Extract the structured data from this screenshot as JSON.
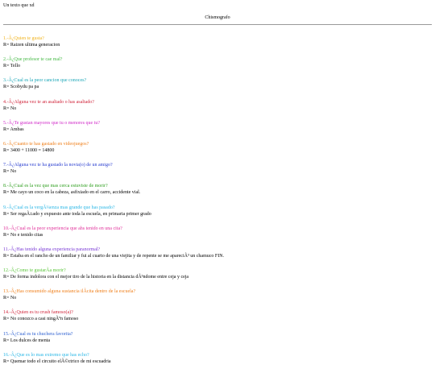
{
  "intro": "Un texto que xd",
  "title": "Chismografo",
  "colors": {
    "orange": "#f39c12",
    "green": "#43b943",
    "teal": "#1aa6b7",
    "red": "#d0243a",
    "magenta": "#d028c8",
    "orange2": "#ef7f1a",
    "blue": "#2b3fd0",
    "lime": "#2e9e1e",
    "sky": "#2bb7e6",
    "pink": "#e0309a",
    "gray": "#333333"
  },
  "questions": [
    {
      "q": "1.-Â¿Quien te gusta?",
      "a": "R= Raizen ultima generacion",
      "color": "#f0b21a"
    },
    {
      "q": "2.-Â¿Que profesor te cae mal?",
      "a": "R= Tello",
      "color": "#43b943"
    },
    {
      "q": "3.-Â¿Cual es la peor cancion que conoces?",
      "a": "R= Scobydu pa pa",
      "color": "#1aa6b7"
    },
    {
      "q": "4.-Â¿Alguna vez te an asaltado o has asaltado?",
      "a": "R= No",
      "color": "#d0243a"
    },
    {
      "q": "5.-Â¿Te gustan mayores que tu o menores que tu?",
      "a": "R= Ambas",
      "color": "#d028c8"
    },
    {
      "q": "6.-Â¿Cuanto te has gastado en videojuegos?",
      "a": "R= 3400 + 11000 = 14800",
      "color": "#ef7f1a"
    },
    {
      "q": "7.-Â¿Alguna vez te ha gustado la novia(o) de un amigo?",
      "a": "R= No",
      "color": "#2b3fd0"
    },
    {
      "q": "8.-Â¿Cual es la vez que mas cerca estuviste de morir?",
      "a": "R= Me cayo un coco en la cabeza, asfixiado en el carro, accidente vial.",
      "color": "#2e9e1e"
    },
    {
      "q": "9.-Â¿Cual es la vergÃ¼enza mas grande que has pasado?",
      "a": "R= Ser regaÃ±ado y expuesto ante toda la escuela, en primaria primer grado",
      "color": "#2bb7e6"
    },
    {
      "q": "10.-Â¿Cual es la peor experiencia que ahs tenido en una cita?",
      "a": "R= No e tenido citas",
      "color": "#e0309a"
    },
    {
      "q": "11.-Â¿Has tenido alguna experiencia paranormal?",
      "a": "R= Estaba en el rancho de un familiar y fui al cuarto de una viejita y de repente se me apareciÃ³ un chamuco FIN.",
      "color": "#7a3ad6"
    },
    {
      "q": "12.-Â¿Como te gustarÃ­a morir?",
      "a": "R= De forma indolora con el mejor tiro de la historia en la distancia dÃ³ndome entre ceja y ceja",
      "color": "#5ac53a"
    },
    {
      "q": "13.-Â¿Has consumido alguna sustancia ilÃ­cita dentro de la escuela?",
      "a": "R= No",
      "color": "#ef7f1a"
    },
    {
      "q": "14.-Â¿Quien es tu crush famoso(a)?",
      "a": "R= No conozco a casi ningÃºn famoso",
      "color": "#d0243a"
    },
    {
      "q": "15.-Â¿Cual es tu chuchera favorita?",
      "a": "R= Los dulces de menta",
      "color": "#2b5fd0"
    },
    {
      "q": "16.-Â¿Que es lo mas extremo que has echo?",
      "a": "R= Quemar todo el circuito elÃ©ctrico de mi escuadria",
      "color": "#2bb7e6"
    }
  ]
}
